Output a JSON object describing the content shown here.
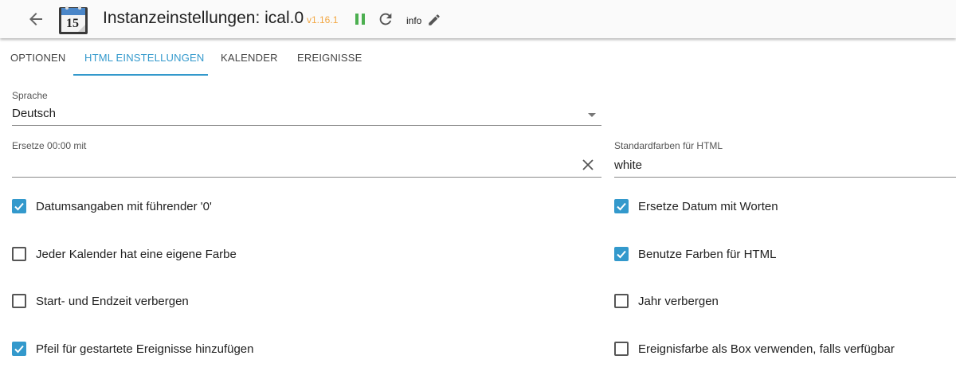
{
  "header": {
    "title": "Instanzeinstellungen: ical.0",
    "version": "v1.16.1",
    "info_label": "info",
    "logo_day": "15",
    "colors": {
      "version": "#f2a743",
      "pause": "#4caf50",
      "accent": "#3399cc"
    }
  },
  "icons": {
    "back": "arrow-left-icon",
    "logo": "calendar-icon",
    "pause": "pause-icon",
    "reload": "reload-icon",
    "edit": "pencil-icon",
    "dropdown": "caret-down-icon",
    "clear": "close-icon",
    "checked": "check-icon"
  },
  "tabs": [
    {
      "label": "OPTIONEN",
      "active": false
    },
    {
      "label": "HTML EINSTELLUNGEN",
      "active": true
    },
    {
      "label": "KALENDER",
      "active": false
    },
    {
      "label": "EREIGNISSE",
      "active": false
    }
  ],
  "fields": {
    "language": {
      "label": "Sprache",
      "value": "Deutsch"
    },
    "replace_midnight": {
      "label": "Ersetze 00:00 mit",
      "value": ""
    },
    "default_color": {
      "label": "Standardfarben für HTML",
      "value": "white"
    }
  },
  "checkboxes": {
    "left": [
      {
        "label": "Datumsangaben mit führender '0'",
        "checked": true
      },
      {
        "label": "Jeder Kalender hat eine eigene Farbe",
        "checked": false
      },
      {
        "label": "Start- und Endzeit verbergen",
        "checked": false
      },
      {
        "label": "Pfeil für gestartete Ereignisse hinzufügen",
        "checked": true
      }
    ],
    "right": [
      {
        "label": "Ersetze Datum mit Worten",
        "checked": true
      },
      {
        "label": "Benutze Farben für HTML",
        "checked": true
      },
      {
        "label": "Jahr verbergen",
        "checked": false
      },
      {
        "label": "Ereignisfarbe als Box verwenden, falls verfügbar",
        "checked": false
      }
    ]
  }
}
